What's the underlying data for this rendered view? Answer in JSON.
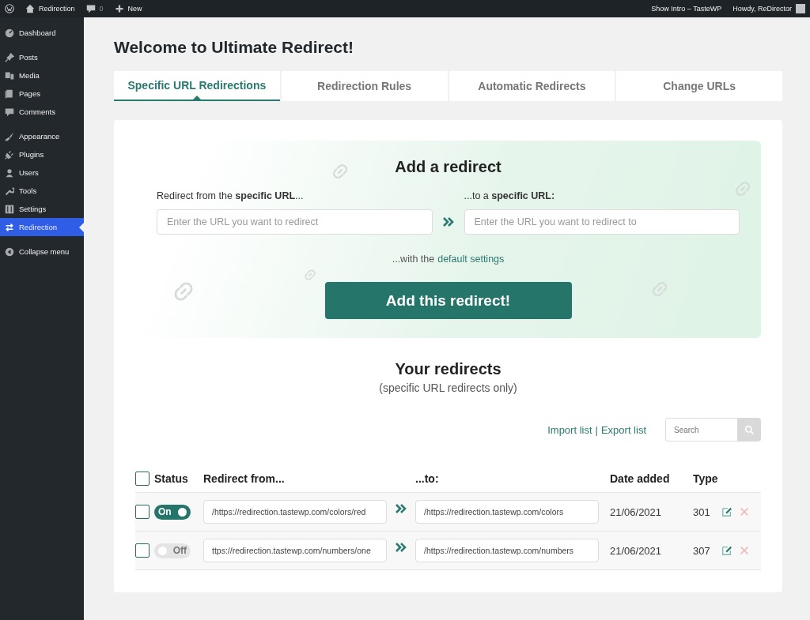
{
  "admin_bar": {
    "site": "Redirection",
    "comments": "0",
    "new": "New",
    "show_intro": "Show Intro – TasteWP",
    "howdy": "Howdy, ReDirector"
  },
  "sidebar": {
    "groups": [
      [
        {
          "label": "Dashboard",
          "selected": false
        }
      ],
      [
        {
          "label": "Posts",
          "selected": false
        },
        {
          "label": "Media",
          "selected": false
        },
        {
          "label": "Pages",
          "selected": false
        },
        {
          "label": "Comments",
          "selected": false
        }
      ],
      [
        {
          "label": "Appearance",
          "selected": false
        },
        {
          "label": "Plugins",
          "selected": false
        },
        {
          "label": "Users",
          "selected": false
        },
        {
          "label": "Tools",
          "selected": false
        },
        {
          "label": "Settings",
          "selected": false
        },
        {
          "label": "Redirection",
          "selected": true
        }
      ]
    ],
    "collapse": "Collapse menu"
  },
  "page_title": "Welcome to Ultimate Redirect!",
  "tabs": [
    {
      "label": "Specific URL Redirections",
      "selected": true
    },
    {
      "label": "Redirection Rules",
      "selected": false
    },
    {
      "label": "Automatic Redirects",
      "selected": false
    },
    {
      "label": "Change URLs",
      "selected": false
    }
  ],
  "add_form": {
    "title": "Add a redirect",
    "from_label": "Redirect from the **specific URL**...",
    "to_label": "...to a **specific URL:**",
    "from_placeholder": "Enter the URL you want to redirect",
    "to_placeholder": "Enter the URL you want to redirect to",
    "settings_prefix": "...with the",
    "settings_link": "default settings",
    "button": "Add this redirect!"
  },
  "redirects": {
    "title": "Your redirects",
    "subtitle": "(specific URL redirects only)",
    "import": "Import list",
    "separator": "|",
    "export": "Export list",
    "search_placeholder": "Search",
    "columns": [
      "Status",
      "Redirect from...",
      "...to:",
      "Date added",
      "Type"
    ],
    "select_all_checked": false,
    "rows": [
      {
        "checked": false,
        "on": true,
        "status": "On",
        "from": "/https://redirection.tastewp.com/colors/red",
        "to": "/https://redirection.tastewp.com/colors",
        "date": "21/06/2021",
        "type": "301"
      },
      {
        "checked": false,
        "on": false,
        "status": "Off",
        "from": "ttps://redirection.tastewp.com/numbers/one",
        "to": "/https://redirection.tastewp.com/numbers",
        "date": "21/06/2021",
        "type": "307"
      }
    ]
  }
}
